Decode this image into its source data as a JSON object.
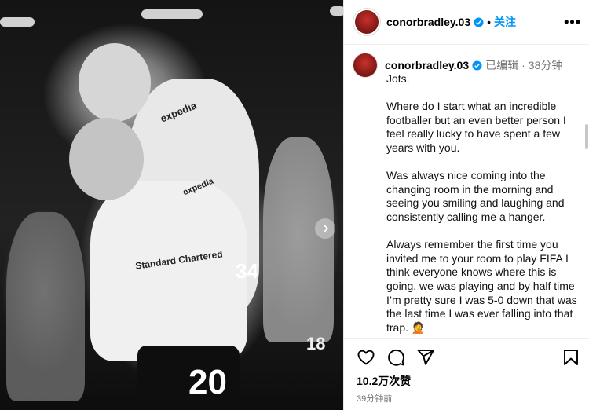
{
  "post": {
    "author": "conorbradley.03",
    "follow_label": "关注",
    "more_label": "•••",
    "separator": "•"
  },
  "photo": {
    "jersey_number_front": "20",
    "jersey_number_back": "34",
    "background_number": "18",
    "sponsor_text": "Standard Chartered",
    "sleeve_sponsor": "expedia"
  },
  "caption": {
    "author": "conorbradley.03",
    "edited_label": "已编辑",
    "separator": "·",
    "time": "38分钟",
    "paragraphs": [
      "Jots.",
      "Where do I start what an incredible footballer but an even better person I feel really lucky to have spent a few years with you.",
      "Was always nice coming into the changing room in the morning and seeing you smiling and laughing and consistently calling me a hanger.",
      "Always remember the first time you invited me to your room to play FIFA I think everyone knows where this is going, we was playing and by half time I’m pretty sure I was 5-0 down that was the last time I was ever falling into that trap. 🤦"
    ]
  },
  "stats": {
    "likes": "10.2万次赞",
    "posted_ago": "39分钟前"
  },
  "colors": {
    "accent": "#0095f6",
    "verified": "#0095f6",
    "muted_text": "#737373"
  },
  "icons": {
    "like": "heart-icon",
    "comment": "comment-icon",
    "share": "share-icon",
    "save": "bookmark-icon",
    "verified": "verified-badge-icon",
    "carousel_next": "chevron-right-icon"
  }
}
